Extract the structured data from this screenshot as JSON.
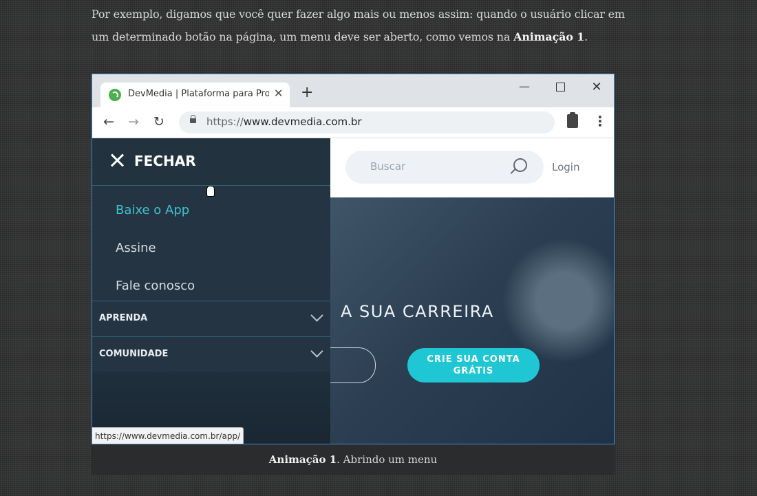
{
  "article": {
    "paragraph_lead": "Por exemplo, digamos que você quer fazer algo mais ou menos assim: quando o usuário clicar em um determinado botão na página, um menu deve ser aberto, como vemos na",
    "paragraph_ref": "Animação 1",
    "paragraph_end": "."
  },
  "browser": {
    "tab_title": "DevMedia | Plataforma para Prog",
    "tab_close": "✕",
    "new_tab": "+",
    "minimize": "—",
    "close": "✕",
    "nav_back": "←",
    "nav_forward": "→",
    "nav_reload": "↻",
    "url_prefix": "https://",
    "url_host": "www.devmedia.com.br",
    "kebab": "⋮",
    "status_url": "https://www.devmedia.com.br/app/"
  },
  "site": {
    "search_placeholder": "Buscar",
    "login": "Login",
    "hero_title": "A SUA CARREIRA",
    "cta_line1": "CRIE SUA CONTA",
    "cta_line2": "GRÁTIS"
  },
  "menu": {
    "close_label": "FECHAR",
    "links": [
      "Baixe o App",
      "Assine",
      "Fale conosco"
    ],
    "sections": [
      "APRENDA",
      "COMUNIDADE"
    ]
  },
  "caption": {
    "ref": "Animação 1",
    "text": ". Abrindo um menu"
  },
  "colors": {
    "accent": "#3fc3cf",
    "cta": "#1fc7d4",
    "menu_bg": "#243442"
  }
}
